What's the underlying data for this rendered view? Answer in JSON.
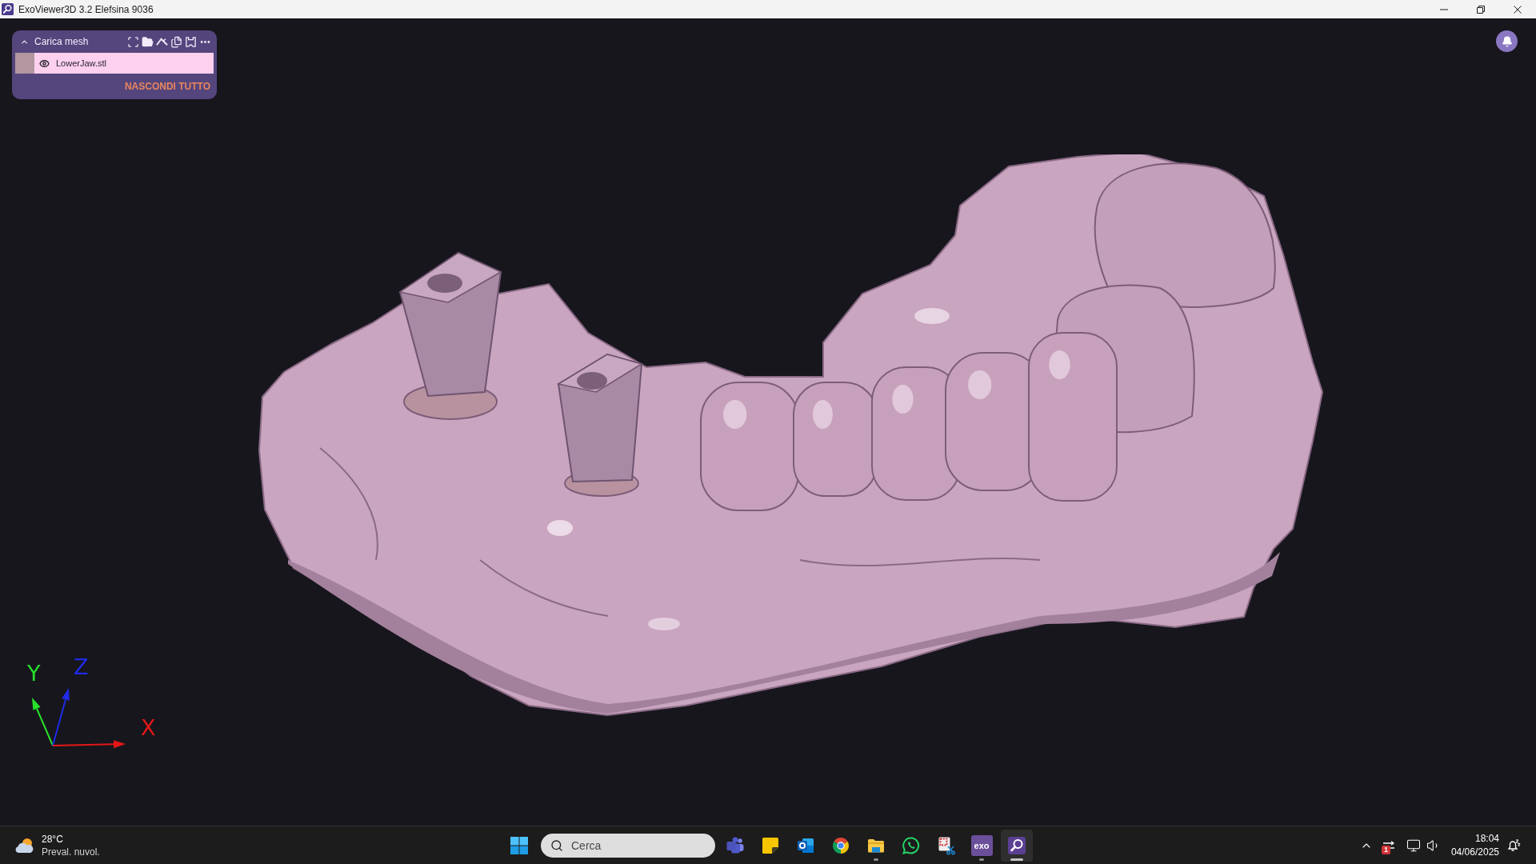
{
  "window": {
    "title": "ExoViewer3D 3.2 Elefsina 9036"
  },
  "mesh_panel": {
    "title": "Carica mesh",
    "expanded": true,
    "meshes": [
      {
        "name": "LowerJaw.stl",
        "visible": true,
        "selected": true,
        "color": "#b3969f"
      }
    ],
    "hide_all": "NASCONDI TUTTO"
  },
  "axes": [
    {
      "kind": "y",
      "label": "Y",
      "color": "#27e02a"
    },
    {
      "kind": "z",
      "label": "Z",
      "color": "#1f2be6"
    },
    {
      "kind": "x",
      "label": "X",
      "color": "#e61717"
    }
  ],
  "taskbar": {
    "weather": {
      "temperature": "28°C",
      "condition": "Preval. nuvol."
    },
    "search": {
      "placeholder": "Cerca"
    },
    "apps": [
      {
        "kind": "people",
        "running": false,
        "active": false
      },
      {
        "kind": "notes",
        "running": false,
        "active": false
      },
      {
        "kind": "mail",
        "running": false,
        "active": false
      },
      {
        "kind": "browser",
        "running": false,
        "active": false
      },
      {
        "kind": "folder",
        "running": true,
        "active": false
      },
      {
        "kind": "chat",
        "running": false,
        "active": false
      },
      {
        "kind": "snip",
        "running": false,
        "active": false
      },
      {
        "kind": "exo",
        "label": "exo",
        "running": true,
        "active": false
      },
      {
        "kind": "viewer",
        "running": true,
        "active": true
      }
    ],
    "tray": {
      "badge": "1"
    },
    "clock": {
      "time": "18:04",
      "date": "04/06/2025"
    }
  }
}
